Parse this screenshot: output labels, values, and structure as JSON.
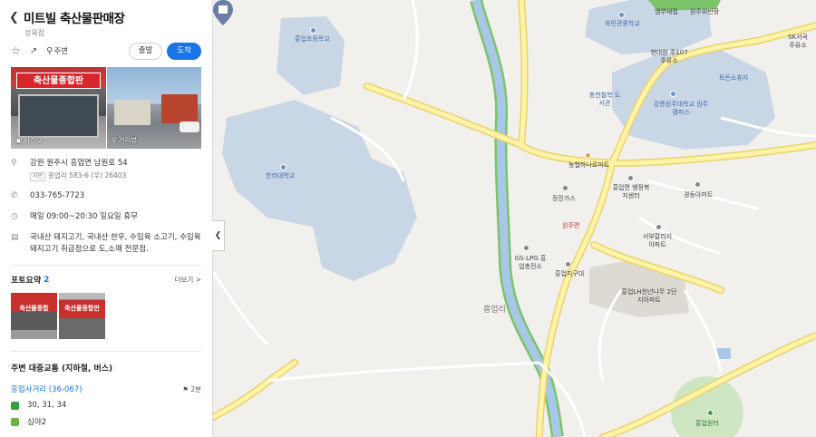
{
  "place": {
    "title": "미트빌 축산물판매장",
    "subtitle": "정육점",
    "back_icon": "chevron-left-icon"
  },
  "actions": {
    "nearby_label": "주변",
    "depart_label": "출발",
    "arrive_label": "도착"
  },
  "photos": {
    "sign_text": "축산물종합판",
    "photo_label": "사진 2",
    "roadview_label": "거리뷰"
  },
  "info": {
    "address": "강원 원주시 흥업면 남원로 54",
    "jibun_tag": "지번",
    "jibun": "흥업리 583-6 (우) 26403",
    "phone": "033-765-7723",
    "hours": "매일 09:00~20:30 일요일 휴무",
    "description": "국내산 돼지고기, 국내산 한우, 수입육 소고기, 수입육 돼지고기 취급점으로 도,소매 전문점."
  },
  "photo_summary": {
    "title": "포토요약",
    "count": "2",
    "more_label": "더보기 >",
    "thumb1_text": "축산물종합",
    "thumb2_text": "축산물종합판"
  },
  "transit": {
    "title": "주변 대중교통 (지하철, 버스)",
    "stop_name": "흥업사거리 (36-067)",
    "walk_time": "2분",
    "bus_routes_1": "30, 31, 34",
    "bus_routes_2": "심야2"
  },
  "map_labels": {
    "school1": "흥업초등학교",
    "univ1": "한라대학교",
    "school2": "육민관중학교",
    "stn1": "엠무새접",
    "stn2": "원주위반랑",
    "stn3": "SK서곡 주유소",
    "gas1": "현대원 주107 주유소",
    "rest": "토돈소휴지",
    "library": "충천철학 도서관",
    "univ2": "강릉원주대학교 원주캠퍼스",
    "mart": "농협하나로마트",
    "office": "흥업면 행정복지센터",
    "apt1": "경동아파트",
    "gas2": "정진가스",
    "gs_lpg": "GS-LPG 흥업충전소",
    "market_label": "원주면",
    "apt2": "서부칼리지 아파트",
    "post": "흥업지구대",
    "apt3": "흥업LH천년나무 2단지아파트",
    "district": "흥업리",
    "park": "흥업원터"
  },
  "colors": {
    "accent": "#1a73e8",
    "road_yellow": "#fff3a8",
    "road_border": "#e9d36b",
    "river": "#a9c8e8",
    "green_band": "#7cc46a",
    "campus": "#c9d6e6"
  }
}
